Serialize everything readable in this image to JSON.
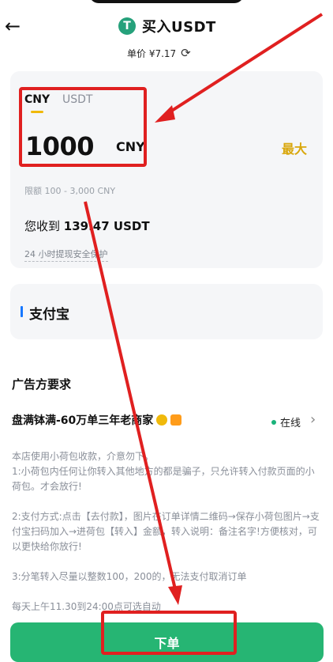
{
  "header": {
    "back_icon": "←",
    "title": "买入USDT",
    "tether_glyph": "T",
    "price_label": "单价 ¥7.17",
    "refresh_icon": "⟳"
  },
  "amount_card": {
    "tabs": [
      "CNY",
      "USDT"
    ],
    "amount": "1000",
    "unit": "CNY",
    "max_label": "最大",
    "limit": "限额 100 - 3,000 CNY",
    "receive_prefix": "您收到",
    "receive_value": "139.47 USDT",
    "protection": "24 小时提现安全保护"
  },
  "payment": {
    "method": "支付宝",
    "accent_color": "#1677ff"
  },
  "advertiser": {
    "section_title": "广告方要求",
    "merchant_name": "盘满钵满-60万单三年老商家",
    "online_label": "在线",
    "chevron_icon": "›",
    "terms": [
      "本店使用小荷包收款，介意勿下。\n1:小荷包内任何让你转入其他地方的都是骗子，只允许转入付款页面的小荷包。才会放行!",
      "2:支付方式:点击【去付款】，图片在订单详情二维码→保存小荷包图片→支付宝扫码加入→进荷包【转入】金额，转入说明：备注名字!方便核对，可以更快给你放行!",
      "3:分笔转入尽量以整数100，200的，无法支付取消订单",
      "每天上午11.30到24:00点可选自动"
    ]
  },
  "footer": {
    "order_button": "下单"
  },
  "colors": {
    "brand_green": "#26b573",
    "usdt_green": "#26a17b",
    "max_gold": "#d9a70c",
    "annotation_red": "#e02020"
  }
}
